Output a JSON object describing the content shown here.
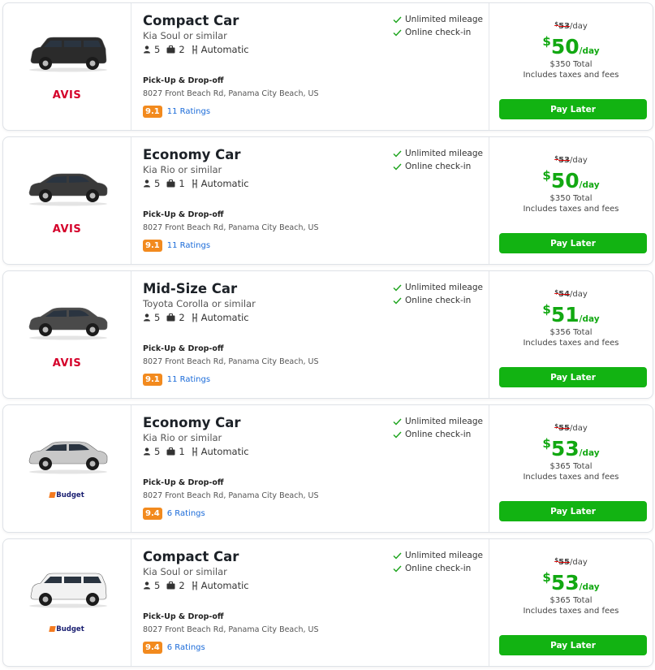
{
  "colors": {
    "accent_green": "#12b312",
    "price_green": "#12a812",
    "rating_orange": "#f28a1e",
    "link_blue": "#1b6bd9",
    "avis_red": "#d4002a"
  },
  "cards": [
    {
      "vendor": "AVIS",
      "vendor_type": "avis",
      "car_color": "#2b2b2b",
      "car_shape": "suv",
      "name": "Compact Car",
      "similar": "Kia Soul or similar",
      "seats": "5",
      "bags": "2",
      "transmission": "Automatic",
      "pickup_label": "Pick-Up & Drop-off",
      "pickup_address": "8027 Front Beach Rd, Panama City Beach, US",
      "score": "9.1",
      "ratings": "11 Ratings",
      "features": [
        "Unlimited mileage",
        "Online check-in"
      ],
      "old_currency": "$",
      "old_amount": "53",
      "old_suffix": "/day",
      "currency": "$",
      "price": "50",
      "per": "/day",
      "total": "$350 Total",
      "fees": "Includes taxes and fees",
      "button": "Pay Later"
    },
    {
      "vendor": "AVIS",
      "vendor_type": "avis",
      "car_color": "#3a3a3a",
      "car_shape": "sedan",
      "name": "Economy Car",
      "similar": "Kia Rio or similar",
      "seats": "5",
      "bags": "1",
      "transmission": "Automatic",
      "pickup_label": "Pick-Up & Drop-off",
      "pickup_address": "8027 Front Beach Rd, Panama City Beach, US",
      "score": "9.1",
      "ratings": "11 Ratings",
      "features": [
        "Unlimited mileage",
        "Online check-in"
      ],
      "old_currency": "$",
      "old_amount": "53",
      "old_suffix": "/day",
      "currency": "$",
      "price": "50",
      "per": "/day",
      "total": "$350 Total",
      "fees": "Includes taxes and fees",
      "button": "Pay Later"
    },
    {
      "vendor": "AVIS",
      "vendor_type": "avis",
      "car_color": "#4a4a4a",
      "car_shape": "sedan",
      "name": "Mid-Size Car",
      "similar": "Toyota Corolla or similar",
      "seats": "5",
      "bags": "2",
      "transmission": "Automatic",
      "pickup_label": "Pick-Up & Drop-off",
      "pickup_address": "8027 Front Beach Rd, Panama City Beach, US",
      "score": "9.1",
      "ratings": "11 Ratings",
      "features": [
        "Unlimited mileage",
        "Online check-in"
      ],
      "old_currency": "$",
      "old_amount": "54",
      "old_suffix": "/day",
      "currency": "$",
      "price": "51",
      "per": "/day",
      "total": "$356 Total",
      "fees": "Includes taxes and fees",
      "button": "Pay Later"
    },
    {
      "vendor": "Budget",
      "vendor_type": "budget",
      "car_color": "#c8c8c8",
      "car_shape": "sedan",
      "name": "Economy Car",
      "similar": "Kia Rio or similar",
      "seats": "5",
      "bags": "1",
      "transmission": "Automatic",
      "pickup_label": "Pick-Up & Drop-off",
      "pickup_address": "8027 Front Beach Rd, Panama City Beach, US",
      "score": "9.4",
      "ratings": "6 Ratings",
      "features": [
        "Unlimited mileage",
        "Online check-in"
      ],
      "old_currency": "$",
      "old_amount": "55",
      "old_suffix": "/day",
      "currency": "$",
      "price": "53",
      "per": "/day",
      "total": "$365 Total",
      "fees": "Includes taxes and fees",
      "button": "Pay Later"
    },
    {
      "vendor": "Budget",
      "vendor_type": "budget",
      "car_color": "#f2f2f2",
      "car_shape": "suv",
      "name": "Compact Car",
      "similar": "Kia Soul or similar",
      "seats": "5",
      "bags": "2",
      "transmission": "Automatic",
      "pickup_label": "Pick-Up & Drop-off",
      "pickup_address": "8027 Front Beach Rd, Panama City Beach, US",
      "score": "9.4",
      "ratings": "6 Ratings",
      "features": [
        "Unlimited mileage",
        "Online check-in"
      ],
      "old_currency": "$",
      "old_amount": "55",
      "old_suffix": "/day",
      "currency": "$",
      "price": "53",
      "per": "/day",
      "total": "$365 Total",
      "fees": "Includes taxes and fees",
      "button": "Pay Later"
    }
  ]
}
